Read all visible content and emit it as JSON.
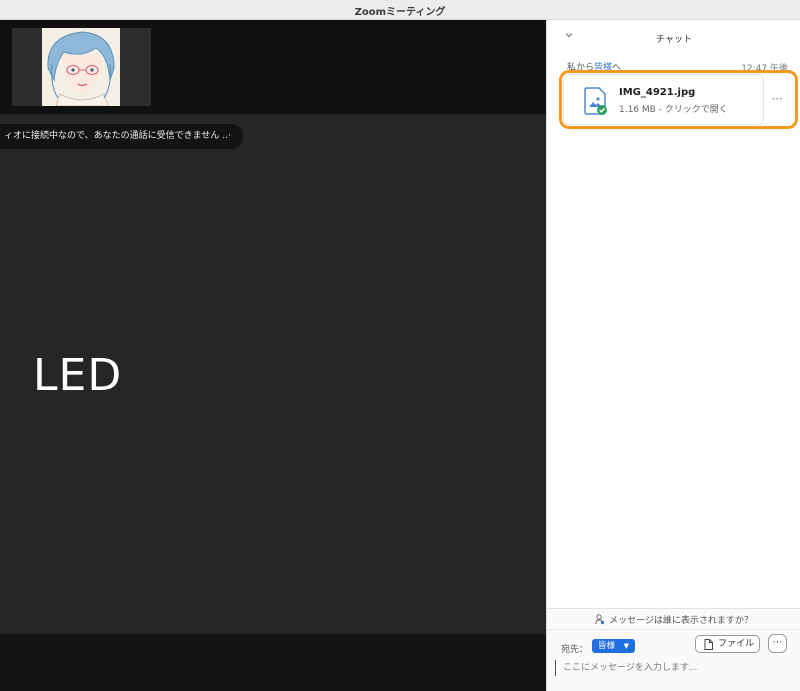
{
  "window": {
    "title": "Zoomミーティング"
  },
  "video": {
    "notice": "ィオに接続中なので、あなたの通話に受信できません ..·",
    "speaker_name": "LED"
  },
  "chat": {
    "title": "チャット",
    "message": {
      "from_prefix": "私から",
      "recipient": "皆様",
      "suffix": "へ",
      "time": "12:47 午後",
      "file": {
        "name": "IMG_4921.jpg",
        "info": "1.16 MB - クリックで開く"
      }
    },
    "visibility_prompt": "メッセージは誰に表示されますか？",
    "to_label": "宛先：",
    "to_value": "皆様",
    "file_button": "ファイル",
    "input_placeholder": "ここにメッセージを入力します..."
  },
  "colors": {
    "highlight": "#f59a1e",
    "accent": "#1f6fe0"
  }
}
